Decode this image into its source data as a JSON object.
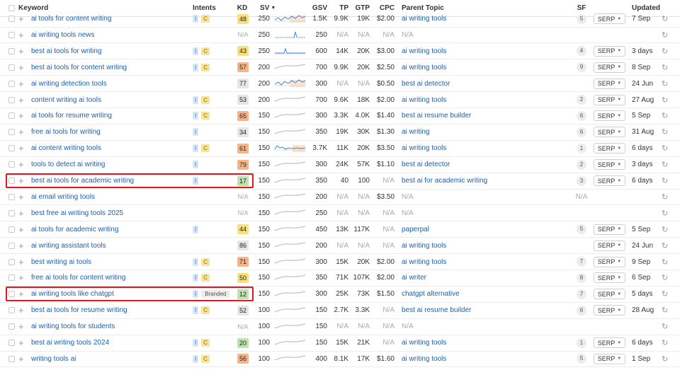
{
  "headers": {
    "keyword": "Keyword",
    "intents": "Intents",
    "kd": "KD",
    "sv": "SV",
    "gsv": "GSV",
    "tp": "TP",
    "gtp": "GTP",
    "cpc": "CPC",
    "parent_topic": "Parent Topic",
    "sf": "SF",
    "updated": "Updated"
  },
  "colors": {
    "kd_green": "#bfe3b0",
    "kd_yellow": "#f9e07a",
    "kd_orange": "#f7b489",
    "kd_gray": "#e6e6e6",
    "link_blue": "#1a5fb4",
    "highlight_red": "#e8141c"
  },
  "rows": [
    {
      "keyword": "ai tools for content writing",
      "intents": [
        "I",
        "C"
      ],
      "kd": "48",
      "kd_color": "#f9e07a",
      "sv": "250",
      "trend": "blue-orange",
      "gsv": "1.5K",
      "tp": "9.9K",
      "gtp": "19K",
      "cpc": "$2.00",
      "parent_topic": "ai writing tools",
      "sf": "5",
      "serp": "SERP",
      "updated": "7 Sep",
      "highlight": false
    },
    {
      "keyword": "ai writing tools news",
      "intents": [],
      "kd": "N/A",
      "kd_color": "",
      "sv": "250",
      "trend": "blue-spike",
      "gsv": "250",
      "tp": "N/A",
      "gtp": "N/A",
      "cpc": "N/A",
      "parent_topic": "N/A",
      "sf": "",
      "serp": "",
      "updated": "",
      "highlight": false
    },
    {
      "keyword": "best ai tools for writing",
      "intents": [
        "I",
        "C"
      ],
      "kd": "43",
      "kd_color": "#f9e07a",
      "sv": "250",
      "trend": "blue-spike2",
      "gsv": "600",
      "tp": "14K",
      "gtp": "20K",
      "cpc": "$3.00",
      "parent_topic": "ai writing tools",
      "sf": "4",
      "serp": "SERP",
      "updated": "3 days",
      "highlight": false
    },
    {
      "keyword": "best ai tools for content writing",
      "intents": [
        "I",
        "C"
      ],
      "kd": "57",
      "kd_color": "#f7b489",
      "sv": "200",
      "trend": "gray",
      "gsv": "700",
      "tp": "9.9K",
      "gtp": "20K",
      "cpc": "$2.50",
      "parent_topic": "ai writing tools",
      "sf": "9",
      "serp": "SERP",
      "updated": "8 Sep",
      "highlight": false
    },
    {
      "keyword": "ai writing detection tools",
      "intents": [],
      "kd": "77",
      "kd_color": "#e6e6e6",
      "sv": "200",
      "trend": "blue-orange",
      "gsv": "300",
      "tp": "N/A",
      "gtp": "N/A",
      "cpc": "$0.50",
      "parent_topic": "best ai detector",
      "sf": "",
      "serp": "SERP",
      "updated": "24 Jun",
      "highlight": false
    },
    {
      "keyword": "content writing ai tools",
      "intents": [
        "I",
        "C"
      ],
      "kd": "53",
      "kd_color": "#e6e6e6",
      "sv": "200",
      "trend": "gray",
      "gsv": "700",
      "tp": "9.6K",
      "gtp": "18K",
      "cpc": "$2.00",
      "parent_topic": "ai writing tools",
      "sf": "2",
      "serp": "SERP",
      "updated": "27 Aug",
      "highlight": false
    },
    {
      "keyword": "ai tools for resume writing",
      "intents": [
        "I",
        "C"
      ],
      "kd": "65",
      "kd_color": "#f7b489",
      "sv": "150",
      "trend": "gray",
      "gsv": "300",
      "tp": "3.3K",
      "gtp": "4.0K",
      "cpc": "$1.40",
      "parent_topic": "best ai resume builder",
      "sf": "6",
      "serp": "SERP",
      "updated": "5 Sep",
      "highlight": false
    },
    {
      "keyword": "free ai tools for writing",
      "intents": [
        "I"
      ],
      "kd": "34",
      "kd_color": "#e6e6e6",
      "sv": "150",
      "trend": "gray",
      "gsv": "350",
      "tp": "19K",
      "gtp": "30K",
      "cpc": "$1.30",
      "parent_topic": "ai writing",
      "sf": "6",
      "serp": "SERP",
      "updated": "31 Aug",
      "highlight": false
    },
    {
      "keyword": "ai content writing tools",
      "intents": [
        "I",
        "C"
      ],
      "kd": "61",
      "kd_color": "#f7b489",
      "sv": "150",
      "trend": "blue-orange2",
      "gsv": "3.7K",
      "tp": "11K",
      "gtp": "20K",
      "cpc": "$3.50",
      "parent_topic": "ai writing tools",
      "sf": "1",
      "serp": "SERP",
      "updated": "6 days",
      "highlight": false
    },
    {
      "keyword": "tools to detect ai writing",
      "intents": [
        "I"
      ],
      "kd": "79",
      "kd_color": "#f7b489",
      "sv": "150",
      "trend": "gray",
      "gsv": "300",
      "tp": "24K",
      "gtp": "57K",
      "cpc": "$1.10",
      "parent_topic": "best ai detector",
      "sf": "2",
      "serp": "SERP",
      "updated": "3 days",
      "highlight": false
    },
    {
      "keyword": "best ai tools for academic writing",
      "intents": [
        "I"
      ],
      "kd": "17",
      "kd_color": "#bfe3b0",
      "sv": "150",
      "trend": "gray",
      "gsv": "350",
      "tp": "40",
      "gtp": "100",
      "cpc": "N/A",
      "parent_topic": "best ai for academic writing",
      "sf": "3",
      "serp": "SERP",
      "updated": "6 days",
      "highlight": true
    },
    {
      "keyword": "ai email writing tools",
      "intents": [],
      "kd": "N/A",
      "kd_color": "",
      "sv": "150",
      "trend": "gray",
      "gsv": "200",
      "tp": "N/A",
      "gtp": "N/A",
      "cpc": "$3.50",
      "parent_topic": "N/A",
      "sf": "N/A",
      "serp": "",
      "updated": "",
      "highlight": false
    },
    {
      "keyword": "best free ai writing tools 2025",
      "intents": [],
      "kd": "N/A",
      "kd_color": "",
      "sv": "150",
      "trend": "gray",
      "gsv": "250",
      "tp": "N/A",
      "gtp": "N/A",
      "cpc": "N/A",
      "parent_topic": "N/A",
      "sf": "",
      "serp": "",
      "updated": "",
      "highlight": false
    },
    {
      "keyword": "ai tools for academic writing",
      "intents": [
        "I"
      ],
      "kd": "44",
      "kd_color": "#f9e07a",
      "sv": "150",
      "trend": "gray",
      "gsv": "450",
      "tp": "13K",
      "gtp": "117K",
      "cpc": "N/A",
      "parent_topic": "paperpal",
      "sf": "5",
      "serp": "SERP",
      "updated": "5 Sep",
      "highlight": false
    },
    {
      "keyword": "ai writing assistant tools",
      "intents": [],
      "kd": "86",
      "kd_color": "#e6e6e6",
      "sv": "150",
      "trend": "gray",
      "gsv": "200",
      "tp": "N/A",
      "gtp": "N/A",
      "cpc": "N/A",
      "parent_topic": "ai writing tools",
      "sf": "",
      "serp": "SERP",
      "updated": "24 Jun",
      "highlight": false
    },
    {
      "keyword": "best writing ai tools",
      "intents": [
        "I",
        "C"
      ],
      "kd": "71",
      "kd_color": "#f7b489",
      "sv": "150",
      "trend": "gray",
      "gsv": "300",
      "tp": "15K",
      "gtp": "20K",
      "cpc": "$2.00",
      "parent_topic": "ai writing tools",
      "sf": "7",
      "serp": "SERP",
      "updated": "9 Sep",
      "highlight": false
    },
    {
      "keyword": "free ai tools for content writing",
      "intents": [
        "I",
        "C"
      ],
      "kd": "50",
      "kd_color": "#f9e07a",
      "sv": "150",
      "trend": "gray",
      "gsv": "350",
      "tp": "71K",
      "gtp": "107K",
      "cpc": "$2.00",
      "parent_topic": "ai writer",
      "sf": "8",
      "serp": "SERP",
      "updated": "6 Sep",
      "highlight": false
    },
    {
      "keyword": "ai writing tools like chatgpt",
      "intents": [
        "I",
        "Branded"
      ],
      "kd": "12",
      "kd_color": "#bfe3b0",
      "sv": "150",
      "trend": "gray",
      "gsv": "300",
      "tp": "25K",
      "gtp": "73K",
      "cpc": "$1.50",
      "parent_topic": "chatgpt alternative",
      "sf": "7",
      "serp": "SERP",
      "updated": "5 days",
      "highlight": true
    },
    {
      "keyword": "best ai tools for resume writing",
      "intents": [
        "I",
        "C"
      ],
      "kd": "52",
      "kd_color": "#e6e6e6",
      "sv": "100",
      "trend": "gray",
      "gsv": "150",
      "tp": "2.7K",
      "gtp": "3.3K",
      "cpc": "N/A",
      "parent_topic": "best ai resume builder",
      "sf": "6",
      "serp": "SERP",
      "updated": "28 Aug",
      "highlight": false
    },
    {
      "keyword": "ai writing tools for students",
      "intents": [],
      "kd": "N/A",
      "kd_color": "",
      "sv": "100",
      "trend": "gray",
      "gsv": "150",
      "tp": "N/A",
      "gtp": "N/A",
      "cpc": "N/A",
      "parent_topic": "N/A",
      "sf": "",
      "serp": "",
      "updated": "",
      "highlight": false
    },
    {
      "keyword": "best ai writing tools 2024",
      "intents": [
        "I",
        "C"
      ],
      "kd": "20",
      "kd_color": "#bfe3b0",
      "sv": "100",
      "trend": "gray",
      "gsv": "150",
      "tp": "15K",
      "gtp": "21K",
      "cpc": "N/A",
      "parent_topic": "ai writing tools",
      "sf": "1",
      "serp": "SERP",
      "updated": "6 days",
      "highlight": false
    },
    {
      "keyword": "writing tools ai",
      "intents": [
        "I",
        "C"
      ],
      "kd": "56",
      "kd_color": "#f7b489",
      "sv": "100",
      "trend": "gray",
      "gsv": "400",
      "tp": "8.1K",
      "gtp": "17K",
      "cpc": "$1.60",
      "parent_topic": "ai writing tools",
      "sf": "5",
      "serp": "SERP",
      "updated": "1 Sep",
      "highlight": false
    }
  ]
}
